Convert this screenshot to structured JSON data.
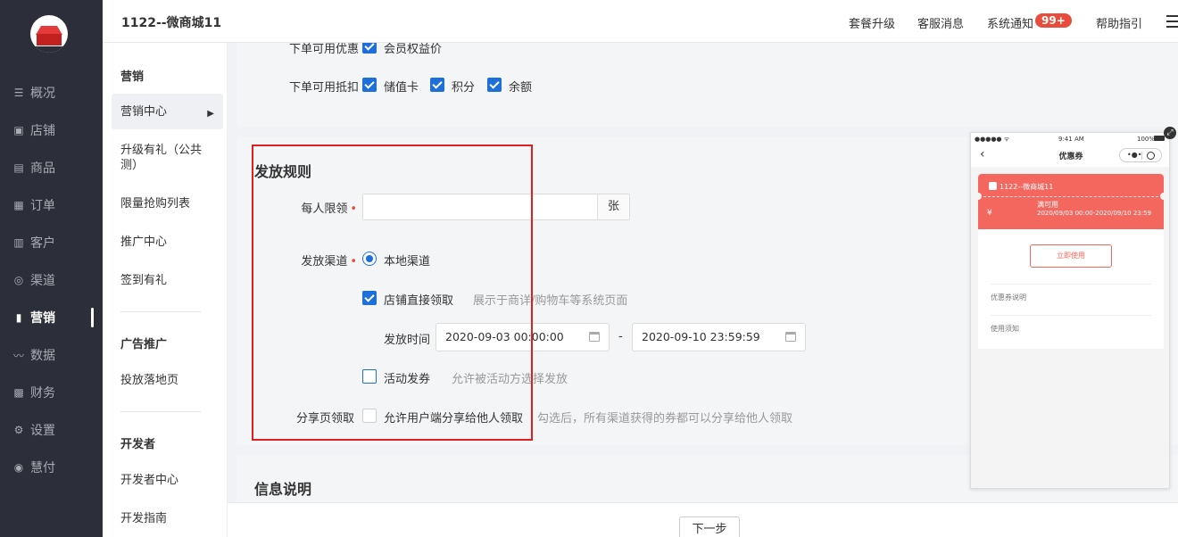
{
  "nav": {
    "items": [
      {
        "icon": "☰",
        "label": "概况",
        "active": false
      },
      {
        "icon": "▣",
        "label": "店铺",
        "active": false
      },
      {
        "icon": "▤",
        "label": "商品",
        "active": false
      },
      {
        "icon": "▦",
        "label": "订单",
        "active": false
      },
      {
        "icon": "▥",
        "label": "客户",
        "active": false
      },
      {
        "icon": "◎",
        "label": "渠道",
        "active": false
      },
      {
        "icon": "▮",
        "label": "营销",
        "active": true
      },
      {
        "icon": "〰",
        "label": "数据",
        "active": false
      },
      {
        "icon": "▩",
        "label": "财务",
        "active": false
      },
      {
        "icon": "⚙",
        "label": "设置",
        "active": false
      },
      {
        "icon": "◉",
        "label": "慧付",
        "active": false
      }
    ]
  },
  "header": {
    "title": "1122--微商城11",
    "links": [
      "套餐升级",
      "客服消息",
      "系统通知",
      "帮助指引"
    ],
    "badge": "99+"
  },
  "subnav": {
    "groups": [
      {
        "title": "营销",
        "items": [
          "营销中心",
          "升级有礼（公共测）",
          "限量抢购列表",
          "推广中心",
          "签到有礼"
        ]
      },
      {
        "title": "广告推广",
        "items": [
          "投放落地页"
        ]
      },
      {
        "title": "开发者",
        "items": [
          "开发者中心",
          "开发指南"
        ]
      }
    ]
  },
  "top_panel": {
    "cut_row_label": "下单可用优惠",
    "cut_row_option": "会员权益价",
    "deduct_label": "下单可用抵扣",
    "deduct_options": [
      "储值卡",
      "积分",
      "余额"
    ]
  },
  "rules": {
    "title": "发放规则",
    "limit_label": "每人限领",
    "limit_value": "",
    "limit_unit": "张",
    "channel_label": "发放渠道",
    "channel_option": "本地渠道",
    "direct_label": "店铺直接领取",
    "direct_hint": "展示于商详/购物车等系统页面",
    "time_label": "发放时间",
    "date_start": "2020-09-03 00:00:00",
    "date_sep": "-",
    "date_end": "2020-09-10 23:59:59",
    "activity_label": "活动发券",
    "activity_hint": "允许被活动方选择发放",
    "share_label": "分享页领取",
    "share_option": "允许用户端分享给他人领取",
    "share_hint": "勾选后，所有渠道获得的券都可以分享给他人领取"
  },
  "info": {
    "title": "信息说明"
  },
  "footer": {
    "next_label": "下一步"
  },
  "phone": {
    "status_left": "●●●●● ᯤ",
    "status_time": "9:41 AM",
    "status_right": "100%",
    "title": "优惠券",
    "capsule_dots": "•●•",
    "shop_name": "1122--微商城11",
    "currency": "¥",
    "condition": "满可用",
    "date_range": "2020/09/03 00:00-2020/09/10 23:59",
    "use_button": "立即使用",
    "desc_label": "优惠券说明",
    "notice_label": "使用须知"
  },
  "colors": {
    "primary": "#1e6fd9",
    "accent_red": "#e74c3c",
    "coupon": "#f4675f",
    "nav_bg": "#2c2f3a"
  }
}
